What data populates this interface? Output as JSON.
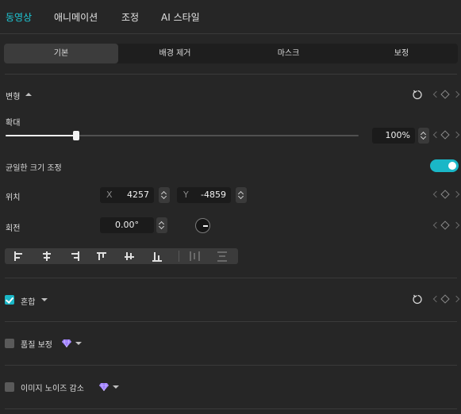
{
  "top_tabs": [
    {
      "label": "동영상",
      "active": true
    },
    {
      "label": "애니메이션",
      "active": false
    },
    {
      "label": "조정",
      "active": false
    },
    {
      "label": "AI 스타일",
      "active": false
    }
  ],
  "sub_tabs": [
    {
      "label": "기본",
      "active": true
    },
    {
      "label": "배경 제거",
      "active": false
    },
    {
      "label": "마스크",
      "active": false
    },
    {
      "label": "보정",
      "active": false
    }
  ],
  "transform": {
    "section_label": "변형",
    "scale_label": "확대",
    "scale_value": "100%",
    "scale_fraction": 0.2,
    "uniform_scale_label": "균일한 크기 조정",
    "uniform_scale_on": true,
    "position_label": "위치",
    "x_axis": "X",
    "x_value": "4257",
    "y_axis": "Y",
    "y_value": "-4859",
    "rotation_label": "회전",
    "rotation_value": "0.00°"
  },
  "blend": {
    "label": "혼합",
    "checked": true
  },
  "quality": {
    "label": "품질 보정",
    "checked": false
  },
  "denoise": {
    "label": "이미지 노이즈 감소",
    "checked": false
  },
  "colors": {
    "accent": "#1ab7c7",
    "premium": "#9b7bff"
  },
  "icons": [
    "reset-icon",
    "keyframe-icon",
    "gem-icon",
    "chevron-down-icon",
    "chevron-up-icon"
  ]
}
